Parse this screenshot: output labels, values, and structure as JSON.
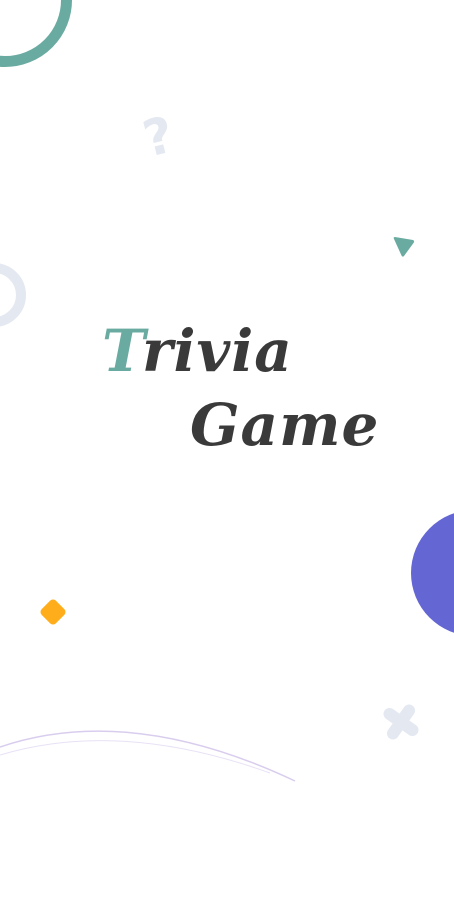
{
  "app": {
    "title_line_1_accent": "T",
    "title_line_1_rest": "rivia",
    "title_line_2": "Game"
  },
  "colors": {
    "background": "#ffffff",
    "teal": "#6aaba1",
    "dark_text": "#3a3a3a",
    "light_grey": "#e4e8f1",
    "purple": "#6466d3",
    "orange": "#ffad1a",
    "arc": "#d9cdee"
  },
  "decorations": {
    "question_mark": "?",
    "icons": [
      "ring-icon",
      "question-mark-icon",
      "triangle-icon",
      "half-circle-icon",
      "diamond-icon",
      "cross-icon",
      "arc-icon"
    ]
  }
}
